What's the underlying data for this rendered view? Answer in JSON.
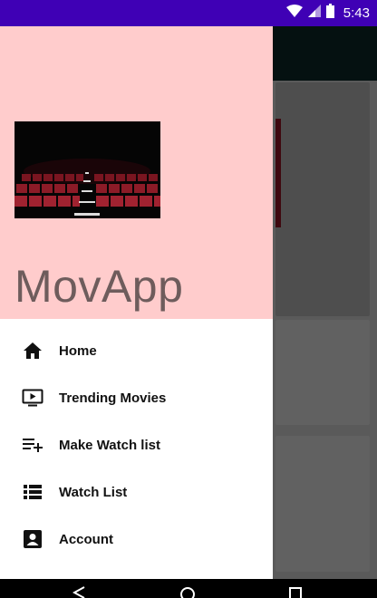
{
  "status_bar": {
    "time": "5:43",
    "icons": [
      "wifi-icon",
      "cell-signal-icon",
      "battery-icon"
    ],
    "color": "#3f00b5"
  },
  "drawer": {
    "app_name": "MovApp",
    "header_color": "#ffcccc",
    "menu": [
      {
        "label": "Home",
        "icon": "home-icon"
      },
      {
        "label": "Trending Movies",
        "icon": "tv-play-icon"
      },
      {
        "label": "Make Watch list",
        "icon": "playlist-add-icon"
      },
      {
        "label": "Watch List",
        "icon": "list-icon"
      },
      {
        "label": "Account",
        "icon": "account-box-icon"
      }
    ]
  },
  "nav_bar": {
    "buttons": [
      "back-icon",
      "home-circle-icon",
      "recents-icon"
    ]
  }
}
